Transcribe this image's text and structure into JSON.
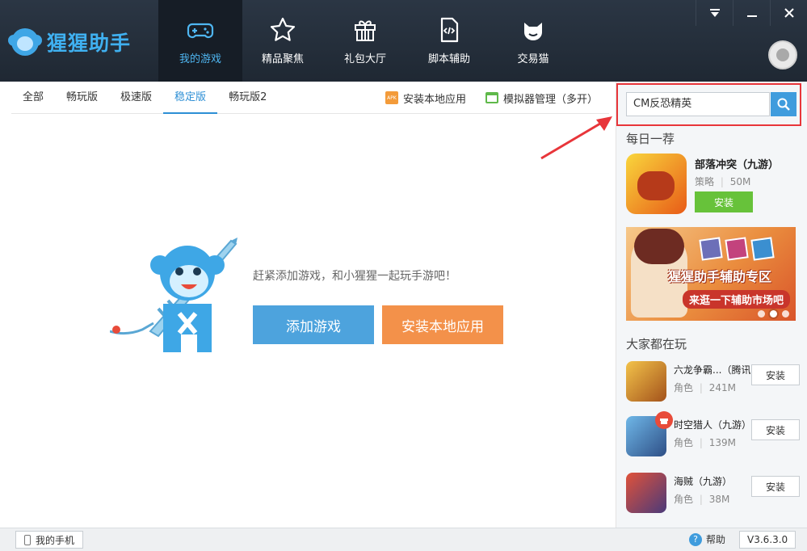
{
  "app": {
    "name": "猩猩助手",
    "version": "V3.6.3.0"
  },
  "nav": {
    "tabs": [
      {
        "label": "我的游戏",
        "icon": "gamepad-icon"
      },
      {
        "label": "精品聚焦",
        "icon": "star-icon"
      },
      {
        "label": "礼包大厅",
        "icon": "gift-icon"
      },
      {
        "label": "脚本辅助",
        "icon": "script-icon"
      },
      {
        "label": "交易猫",
        "icon": "cat-icon"
      }
    ],
    "active_index": 0
  },
  "subtabs": {
    "items": [
      "全部",
      "畅玩版",
      "极速版",
      "稳定版",
      "畅玩版2"
    ],
    "active_index": 3,
    "install_local_label": "安装本地应用",
    "apk_badge": "APK",
    "emulator_label": "模拟器管理（多开）"
  },
  "empty_state": {
    "text": "赶紧添加游戏，和小猩猩一起玩手游吧！",
    "add_button": "添加游戏",
    "install_button": "安装本地应用"
  },
  "search": {
    "value": "CM反恐精英"
  },
  "daily": {
    "title": "每日一荐",
    "game_name": "部落冲突（九游）",
    "category": "策略",
    "separator": "|",
    "size": "50M",
    "install_label": "安装"
  },
  "banner": {
    "title": "猩猩助手辅助专区",
    "subtitle": "来逛一下辅助市场吧",
    "slide_count": 3,
    "active_slide": 1
  },
  "popular": {
    "title": "大家都在玩",
    "games": [
      {
        "name": "六龙争霸...（腾讯",
        "category": "角色",
        "size": "241M",
        "install_label": "安装"
      },
      {
        "name": "时空猎人（九游）",
        "category": "角色",
        "size": "139M",
        "install_label": "安装"
      },
      {
        "name": "海贼（九游）",
        "category": "角色",
        "size": "38M",
        "install_label": "安装"
      }
    ]
  },
  "footer": {
    "my_phone": "我的手机",
    "help": "帮助",
    "help_icon_glyph": "?"
  },
  "colors": {
    "accent": "#3f9cdd",
    "orange": "#f3914a",
    "green": "#67c23a",
    "highlight": "#e8353a"
  }
}
